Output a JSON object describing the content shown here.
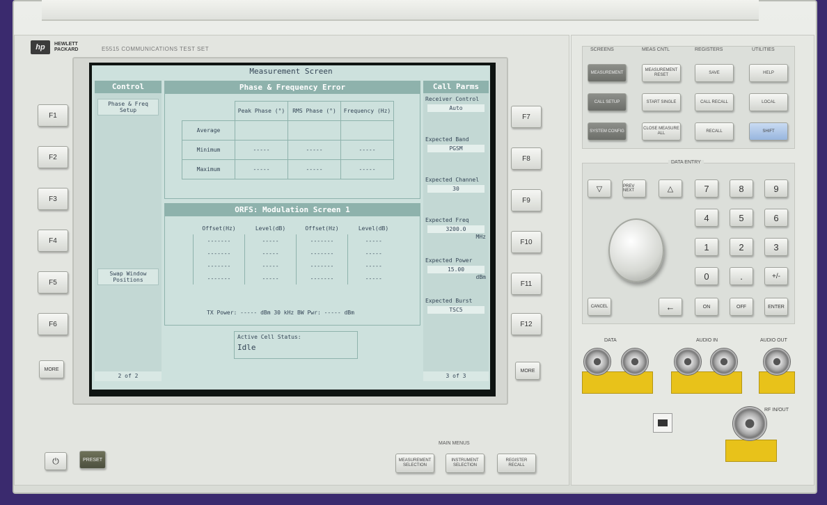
{
  "brand": {
    "logo": "hp",
    "name_line1": "HEWLETT",
    "name_line2": "PACKARD",
    "model": "E5515 COMMUNICATIONS TEST SET"
  },
  "screen": {
    "title": "Measurement Screen",
    "control": {
      "header": "Control",
      "item1": "Phase & Freq Setup",
      "item2": "Swap Window Positions",
      "page": "2 of 2"
    },
    "pfe": {
      "header": "Phase & Frequency Error",
      "columns": [
        "Peak Phase (°)",
        "RMS Phase (°)",
        "Frequency (Hz)"
      ],
      "rows": [
        {
          "label": "Average",
          "values": [
            "",
            "",
            ""
          ]
        },
        {
          "label": "Minimum",
          "values": [
            "-----",
            "-----",
            "-----"
          ]
        },
        {
          "label": "Maximum",
          "values": [
            "-----",
            "-----",
            "-----"
          ]
        }
      ]
    },
    "orfs": {
      "header": "ORFS: Modulation Screen 1",
      "columns": [
        "Offset(Hz)",
        "Level(dB)",
        "Offset(Hz)",
        "Level(dB)"
      ],
      "rows": [
        [
          "-------",
          "-----",
          "-------",
          "-----"
        ],
        [
          "-------",
          "-----",
          "-------",
          "-----"
        ],
        [
          "-------",
          "-----",
          "-------",
          "-----"
        ],
        [
          "-------",
          "-----",
          "-------",
          "-----"
        ]
      ],
      "tx_line": "TX Power: ----- dBm  30 kHz BW Pwr: ----- dBm"
    },
    "status": {
      "label": "Active Cell Status:",
      "value": "Idle"
    },
    "callparms": {
      "header": "Call Parms",
      "items": [
        {
          "label": "Receiver Control",
          "value": "Auto"
        },
        {
          "label": "Expected Band",
          "value": "PGSM"
        },
        {
          "label": "Expected Channel",
          "value": "30"
        },
        {
          "label": "Expected Freq",
          "value": "3200.0",
          "unit": "MHz"
        },
        {
          "label": "Expected Power",
          "value": "15.00",
          "unit": "dBm"
        },
        {
          "label": "Expected Burst",
          "value": "TSC5"
        }
      ],
      "page": "3 of 3"
    }
  },
  "fkeys_left": [
    "F1",
    "F2",
    "F3",
    "F4",
    "F5",
    "F6"
  ],
  "fkeys_right": [
    "F7",
    "F8",
    "F9",
    "F10",
    "F11",
    "F12"
  ],
  "more_left": "MORE",
  "more_right": "MORE",
  "power": {
    "standby": "⏻",
    "preset": "PRESET"
  },
  "groups": {
    "screens": "SCREENS",
    "meas_cntl": "MEAS CNTL",
    "registers": "REGISTERS",
    "utilities": "UTILITIES"
  },
  "screens_keys": [
    "MEASUREMENT",
    "CALL SETUP",
    "SYSTEM CONFIG"
  ],
  "meas_keys": [
    "MEASUREMENT RESET",
    "START SINGLE",
    "CLOSE MEASURE ALL"
  ],
  "register_keys": [
    "SAVE",
    "CALL RECALL",
    "RECALL"
  ],
  "utility_keys": [
    "HELP",
    "LOCAL",
    "SHIFT"
  ],
  "data_entry": {
    "label": "DATA ENTRY",
    "nav": [
      "▽",
      "PREV NEXT",
      "△"
    ],
    "numbers": [
      "7",
      "8",
      "9",
      "4",
      "5",
      "6",
      "1",
      "2",
      "3",
      "0",
      ".",
      "+/-"
    ],
    "bottom": [
      "CANCEL",
      "←",
      "ON",
      "OFF",
      "ENTER"
    ]
  },
  "connectors": {
    "data": "DATA",
    "audio_in": "AUDIO IN",
    "audio_out": "AUDIO OUT",
    "rf": "RF IN/OUT"
  },
  "menu": {
    "label": "MAIN MENUS",
    "keys": [
      "MEASUREMENT SELECTION",
      "INSTRUMENT SELECTION",
      "REGISTER RECALL"
    ]
  }
}
